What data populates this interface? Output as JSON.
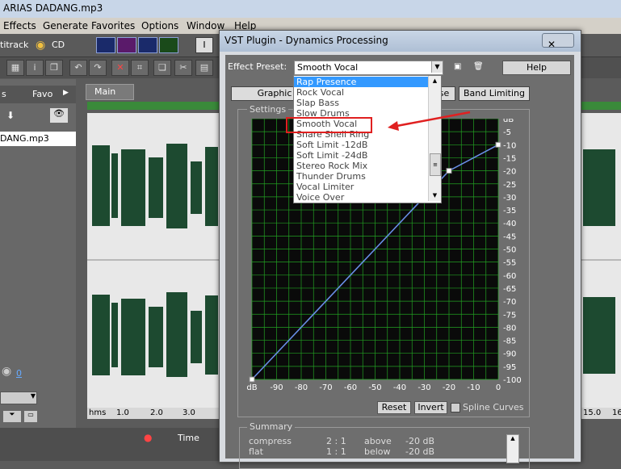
{
  "app": {
    "title": "ARIAS DADANG.mp3",
    "menu": [
      "Effects",
      "Generate",
      "Favorites",
      "Options",
      "Window",
      "Help"
    ],
    "toolbar_labels": {
      "multitrack": "titrack",
      "cd": "CD"
    },
    "left_tabs": [
      "s",
      "Favo"
    ],
    "file_name": "DANG.mp3",
    "main_tab": "Main",
    "time_tab": "Time",
    "ruler_ticks": [
      "hms",
      "1.0",
      "2.0",
      "3.0"
    ],
    "right_ruler_ticks": [
      "15.0",
      "16"
    ],
    "volume_value": "0"
  },
  "dialog": {
    "title": "VST Plugin - Dynamics Processing",
    "preset_label": "Effect Preset:",
    "preset_value": "Smooth Vocal",
    "help_label": "Help",
    "tabs": {
      "graphic": "Graphic",
      "hidden": "se",
      "band": "Band Limiting"
    },
    "settings_label": "Settings",
    "reset_label": "Reset",
    "invert_label": "Invert",
    "spline_label": "Spline Curves",
    "summary_label": "Summary",
    "summary_rows": [
      {
        "type": "compress",
        "ratio": "2 : 1",
        "cond": "above",
        "level": "-20 dB"
      },
      {
        "type": "flat",
        "ratio": "1 : 1",
        "cond": "below",
        "level": "-20 dB"
      }
    ],
    "presets": [
      "Rap Presence",
      "Rock Vocal",
      "Slap Bass",
      "Slow Drums",
      "Smooth Vocal",
      "Snare Shell Ring",
      "Soft Limit -12dB",
      "Soft Limit -24dB",
      "Stereo Rock Mix",
      "Thunder Drums",
      "Vocal Limiter",
      "Voice Over"
    ],
    "highlighted_preset": "Smooth Vocal",
    "selected_preset": "Rap Presence",
    "graph": {
      "x_ticks": [
        "dB",
        "-90",
        "-80",
        "-70",
        "-60",
        "-50",
        "-40",
        "-30",
        "-20",
        "-10",
        "0"
      ],
      "y_ticks": [
        "dB",
        "-5",
        "-10",
        "-15",
        "-20",
        "-25",
        "-30",
        "-35",
        "-40",
        "-45",
        "-50",
        "-55",
        "-60",
        "-65",
        "-70",
        "-75",
        "-80",
        "-85",
        "-90",
        "-95",
        "-100"
      ],
      "curve_points": [
        {
          "in": -100,
          "out": -100
        },
        {
          "in": -20,
          "out": -20
        },
        {
          "in": 0,
          "out": -10
        }
      ],
      "colors": {
        "background": "#0a0a0a",
        "grid": "#22a022",
        "curve": "#6a8fe8"
      }
    }
  }
}
